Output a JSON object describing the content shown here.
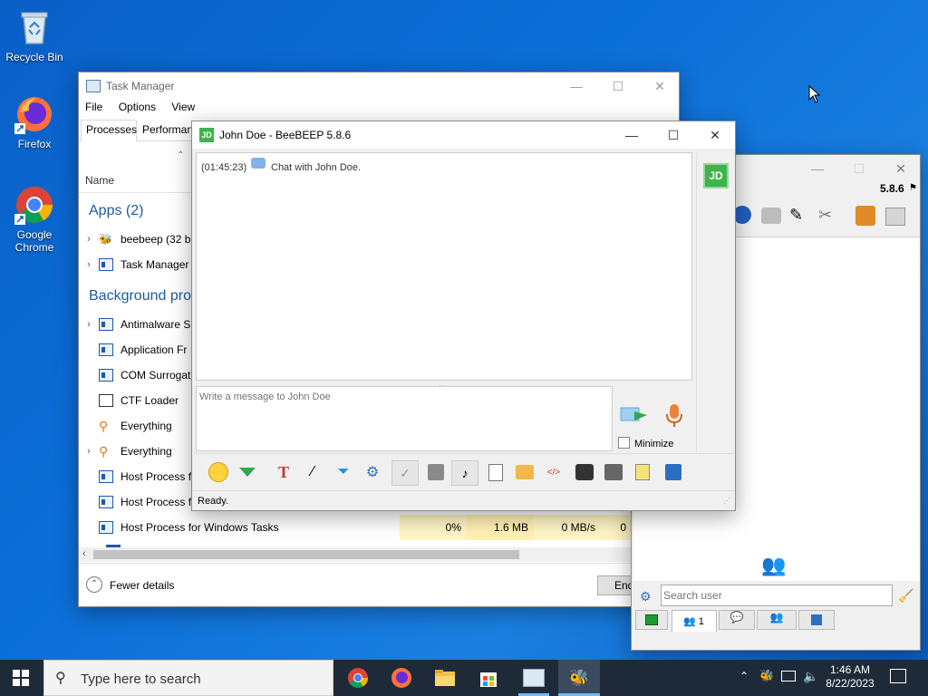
{
  "desktop": {
    "icons": [
      {
        "label": "Recycle Bin"
      },
      {
        "label": "Firefox"
      },
      {
        "label": "Google Chrome"
      }
    ]
  },
  "task_manager": {
    "title": "Task Manager",
    "menu": [
      "File",
      "Options",
      "View"
    ],
    "tabs": [
      "Processes",
      "Performan"
    ],
    "column_name": "Name",
    "apps_header": "Apps (2)",
    "apps": [
      "beebeep (32 b",
      "Task Manager"
    ],
    "bg_header": "Background proc",
    "background": [
      "Antimalware S",
      "Application Fr",
      "COM Surrogat",
      "CTF Loader",
      "Everything",
      "Everything",
      "Host Process f",
      "Host Process f",
      "Host Process for Windows Tasks"
    ],
    "last_row_values": [
      "0%",
      "1.6 MB",
      "0 MB/s",
      "0"
    ],
    "fewer_details": "Fewer details",
    "end_button": "End"
  },
  "chat": {
    "title": "John Doe - BeeBEEP 5.8.6",
    "avatar_initials": "JD",
    "message_time": "(01:45:23)",
    "message_text": "Chat with John Doe.",
    "input_placeholder": "Write a message to John Doe",
    "minimize_label": "Minimize",
    "status": "Ready."
  },
  "beebeep_main": {
    "version": "5.8.6",
    "search_placeholder": "Search user",
    "tab_count": "1"
  },
  "taskbar": {
    "search_placeholder": "Type here to search",
    "time": "1:46 AM",
    "date": "8/22/2023"
  },
  "colors": {
    "accent_blue": "#0078d7",
    "desktop": "#0b6fd8",
    "jd_green": "#3cb44b"
  }
}
